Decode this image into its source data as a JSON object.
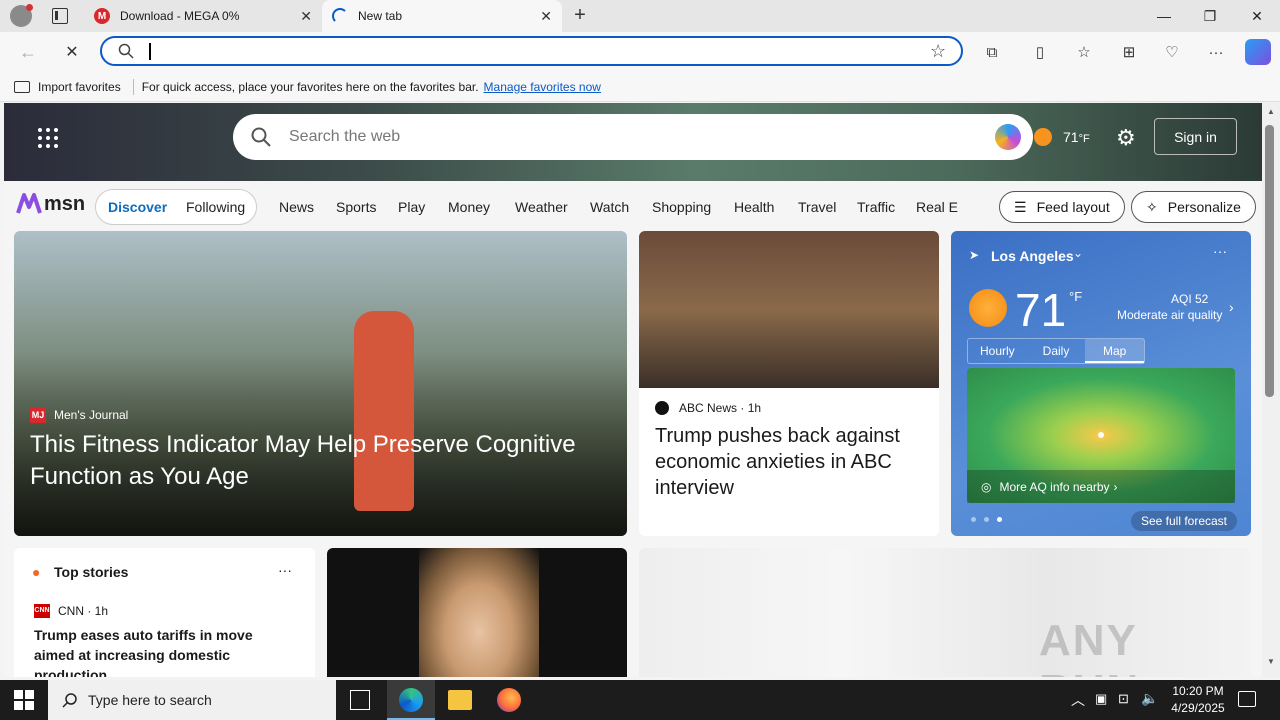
{
  "browser": {
    "tabs": [
      {
        "title": "Download - MEGA 0%",
        "favicon": "mega-icon"
      },
      {
        "title": "New tab",
        "favicon": "loading-icon"
      }
    ],
    "address_value": "",
    "favorites_bar": {
      "import_label": "Import favorites",
      "hint": "For quick access, place your favorites here on the favorites bar.",
      "manage_link": "Manage favorites now"
    }
  },
  "msn": {
    "search_placeholder": "Search the web",
    "temp_header": "71",
    "temp_unit": "°F",
    "sign_in": "Sign in",
    "logo": "msn",
    "tabs": [
      "Discover",
      "Following"
    ],
    "nav": [
      "News",
      "Sports",
      "Play",
      "Money",
      "Weather",
      "Watch",
      "Shopping",
      "Health",
      "Travel",
      "Traffic",
      "Real E"
    ],
    "feed_layout": "Feed layout",
    "personalize": "Personalize",
    "hero_article": {
      "source": "Men's Journal",
      "title": "This Fitness Indicator May Help Preserve Cognitive Function as You Age"
    },
    "article2": {
      "source": "ABC News",
      "age": "· 1h",
      "title": "Trump pushes back against economic anxieties in ABC interview"
    },
    "weather": {
      "city": "Los Angeles",
      "temp": "71",
      "unit": "°F",
      "aqi": "AQI 52",
      "aqi_desc": "Moderate air quality",
      "tabs": [
        "Hourly",
        "Daily",
        "Map"
      ],
      "more_aq": "More AQ info nearby",
      "see_forecast": "See full forecast"
    },
    "top_stories": {
      "title": "Top stories",
      "source": "CNN",
      "age": "· 1h",
      "headline": "Trump eases auto tariffs in move aimed at increasing domestic production"
    },
    "watermark": "ANY RUN"
  },
  "taskbar": {
    "search_placeholder": "Type here to search",
    "time": "10:20 PM",
    "date": "4/29/2025"
  },
  "colors": {
    "accent": "#0c59c8",
    "msn_blue": "#0f6cbd",
    "taskbar": "#1c1c1c",
    "weather_card": "#3a6fc4"
  }
}
